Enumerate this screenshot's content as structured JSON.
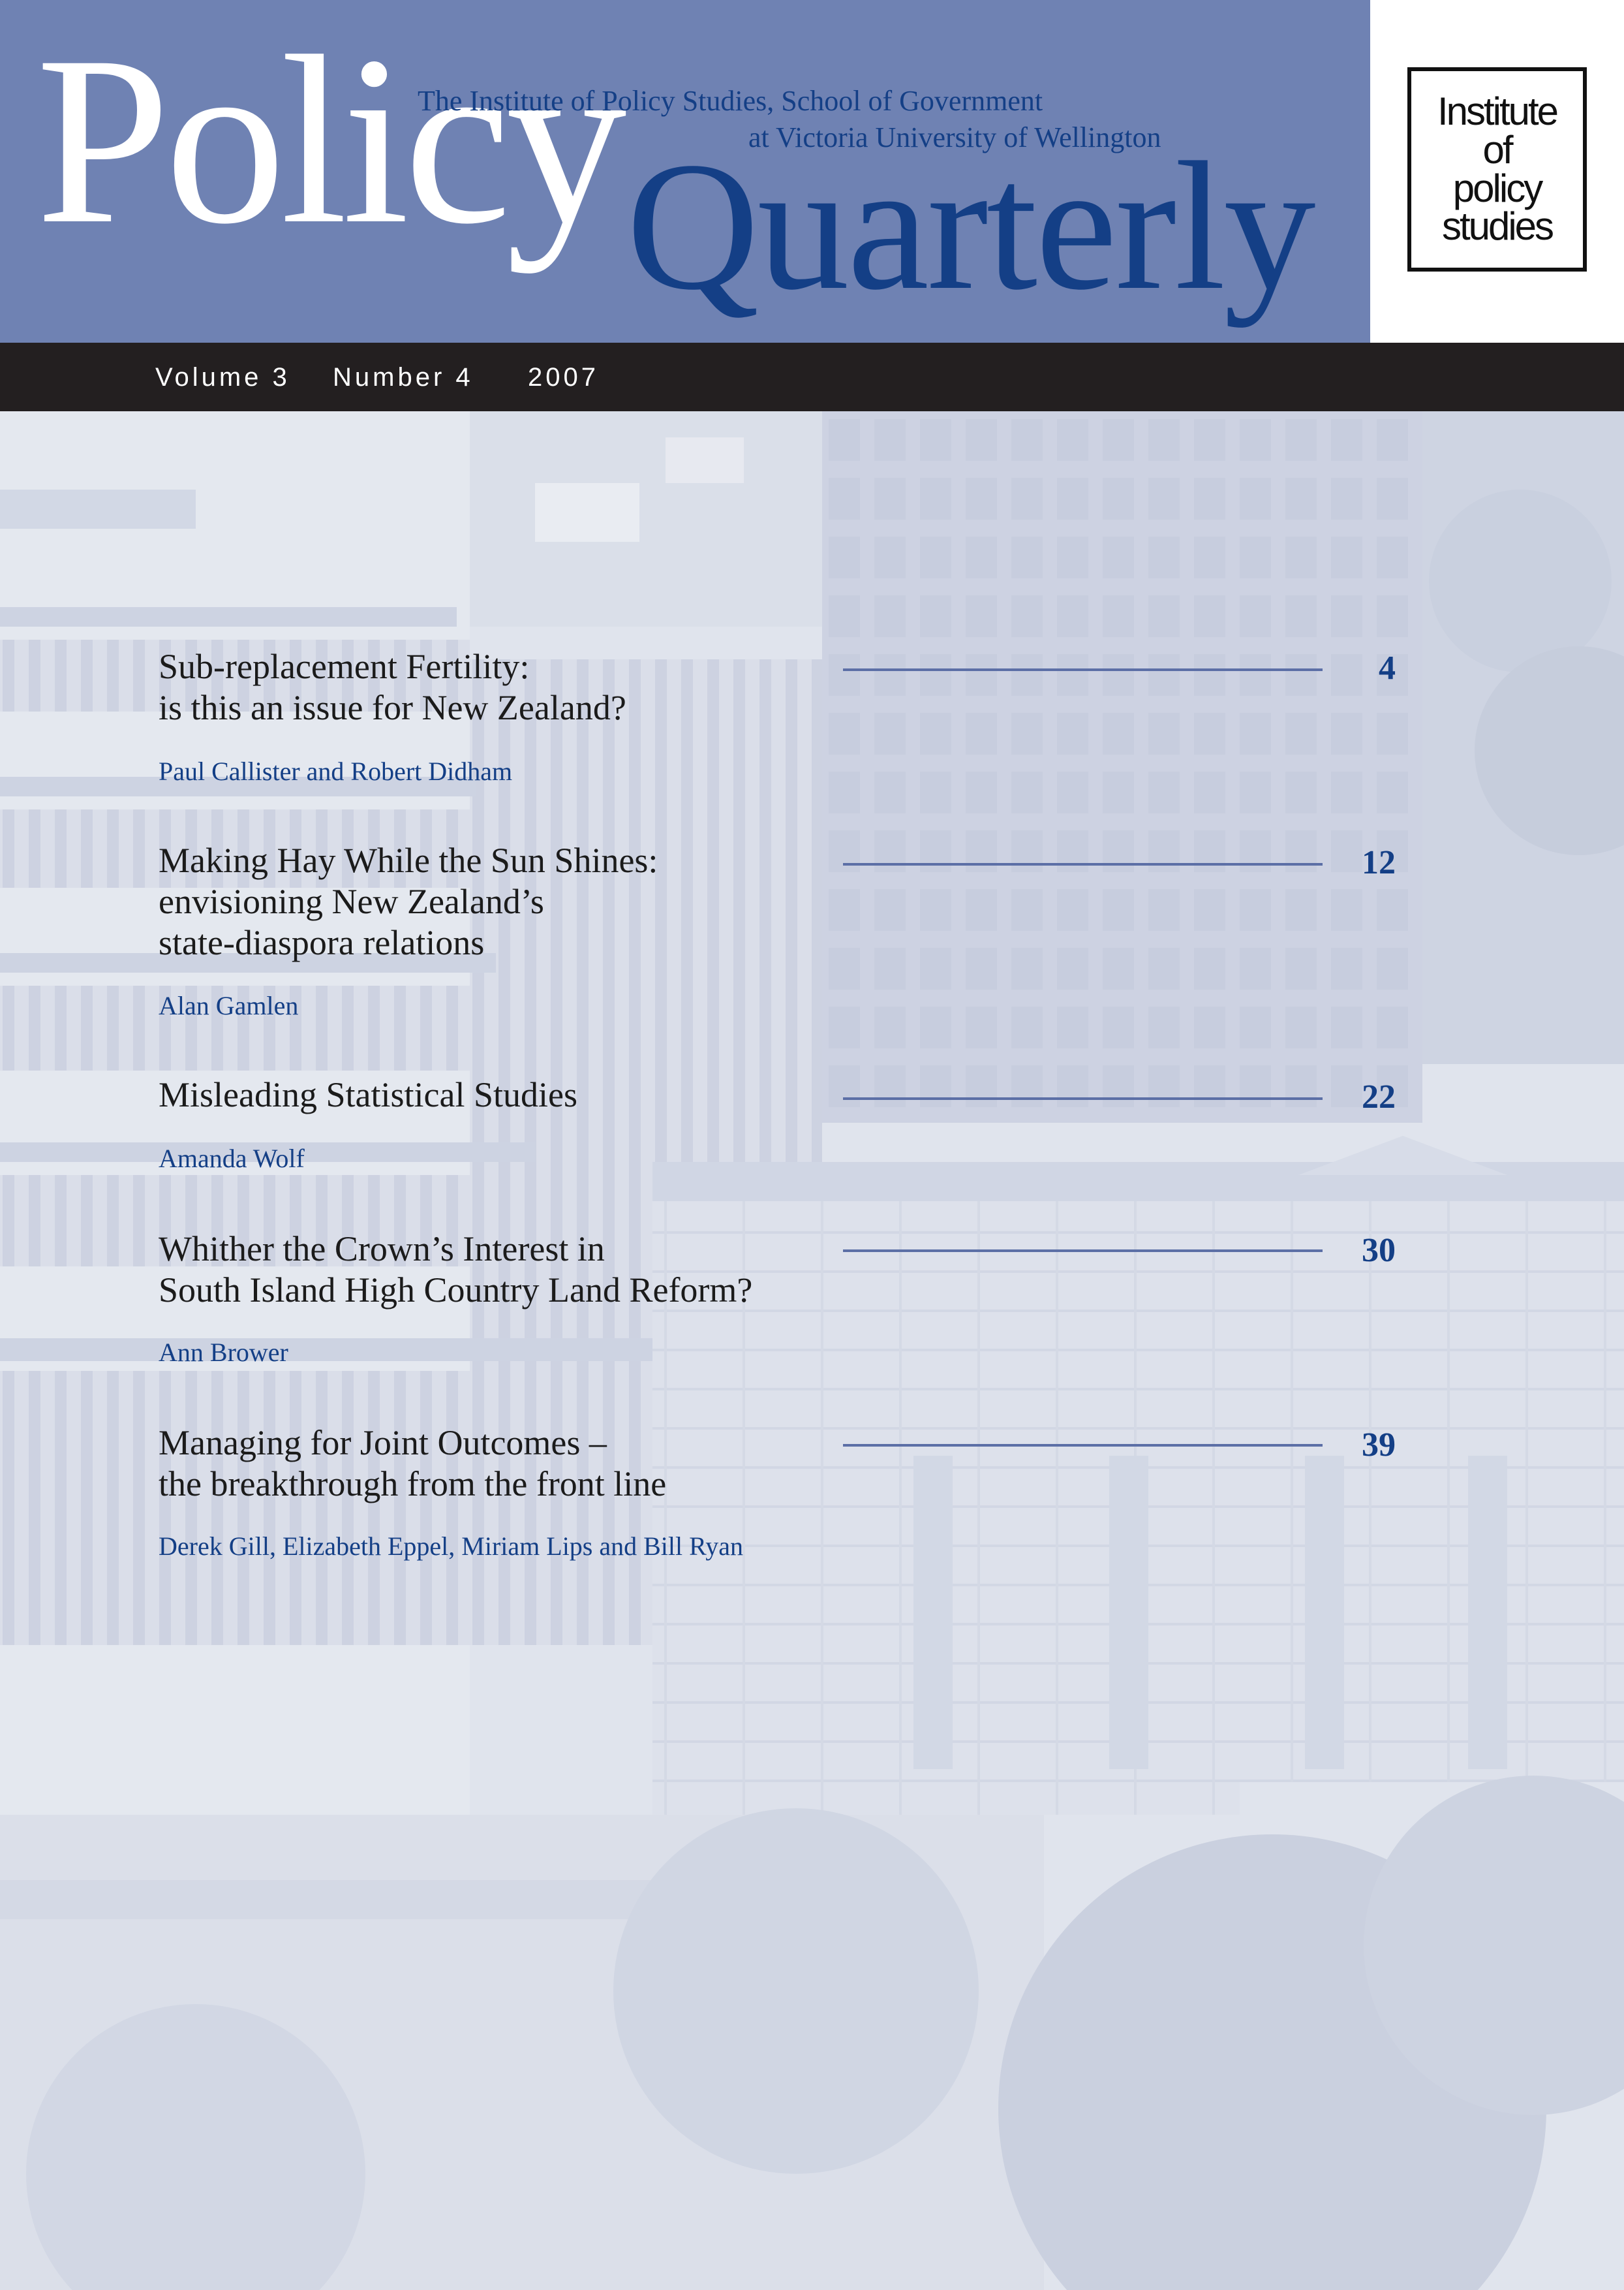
{
  "masthead": {
    "title_part1": "Policy",
    "title_part2": "Quarterly",
    "tagline_line1": "The Institute of Policy Studies, School of Government",
    "tagline_line2": "at Victoria University of Wellington",
    "background_color": "#6f82b3",
    "accent_color": "#143f86"
  },
  "logo": {
    "lines": [
      "Institute",
      "of",
      "policy",
      "studies"
    ]
  },
  "issue": {
    "volume": "Volume 3",
    "number": "Number 4",
    "year": "2007"
  },
  "contents": [
    {
      "title_lines": [
        "Sub-replacement Fertility:",
        "is this an issue for New Zealand?"
      ],
      "authors": "Paul Callister and Robert Didham",
      "page": "4"
    },
    {
      "title_lines": [
        "Making Hay While the Sun Shines:",
        "envisioning New Zealand’s",
        "state-diaspora relations"
      ],
      "authors": "Alan Gamlen",
      "page": "12"
    },
    {
      "title_lines": [
        "Misleading Statistical Studies"
      ],
      "authors": "Amanda Wolf",
      "page": "22"
    },
    {
      "title_lines": [
        "Whither the Crown’s Interest in",
        "South Island High Country Land Reform?"
      ],
      "authors": "Ann Brower",
      "page": "30"
    },
    {
      "title_lines": [
        "Managing for Joint Outcomes –",
        "the breakthrough from the front line"
      ],
      "authors": "Derek Gill, Elizabeth Eppel, Miriam Lips and Bill Ryan",
      "page": "39"
    }
  ]
}
